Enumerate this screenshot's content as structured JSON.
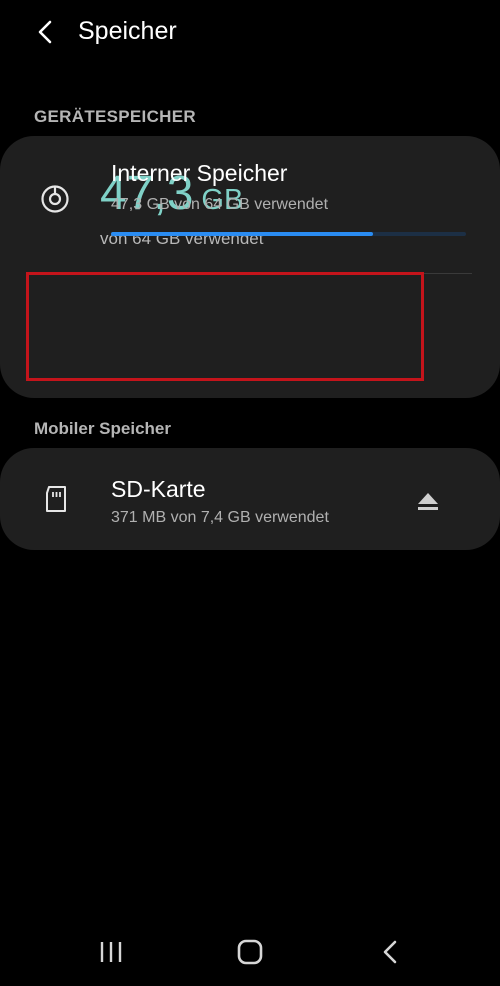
{
  "header": {
    "title": "Speicher"
  },
  "device_storage": {
    "section_label": "GERÄTESPEICHER",
    "used_value": "47,3",
    "used_unit": "GB",
    "used_subtitle": "von 64 GB verwendet",
    "internal": {
      "title": "Interner Speicher",
      "subtitle": "47,3 GB von 64 GB verwendet",
      "used_fraction": 0.739
    }
  },
  "mobile_storage": {
    "section_label": "Mobiler Speicher",
    "sd_card": {
      "title": "SD-Karte",
      "subtitle": "371 MB von 7,4 GB verwendet"
    }
  },
  "icons": {
    "back": "back-arrow-icon",
    "internal": "storage-disc-icon",
    "sd": "sd-card-icon",
    "eject": "eject-icon",
    "nav_recents": "recents-icon",
    "nav_home": "home-icon",
    "nav_back": "nav-back-icon"
  },
  "colors": {
    "accent": "#7fd1c7",
    "progress": "#2a8cf2",
    "highlight": "#c4141b"
  }
}
